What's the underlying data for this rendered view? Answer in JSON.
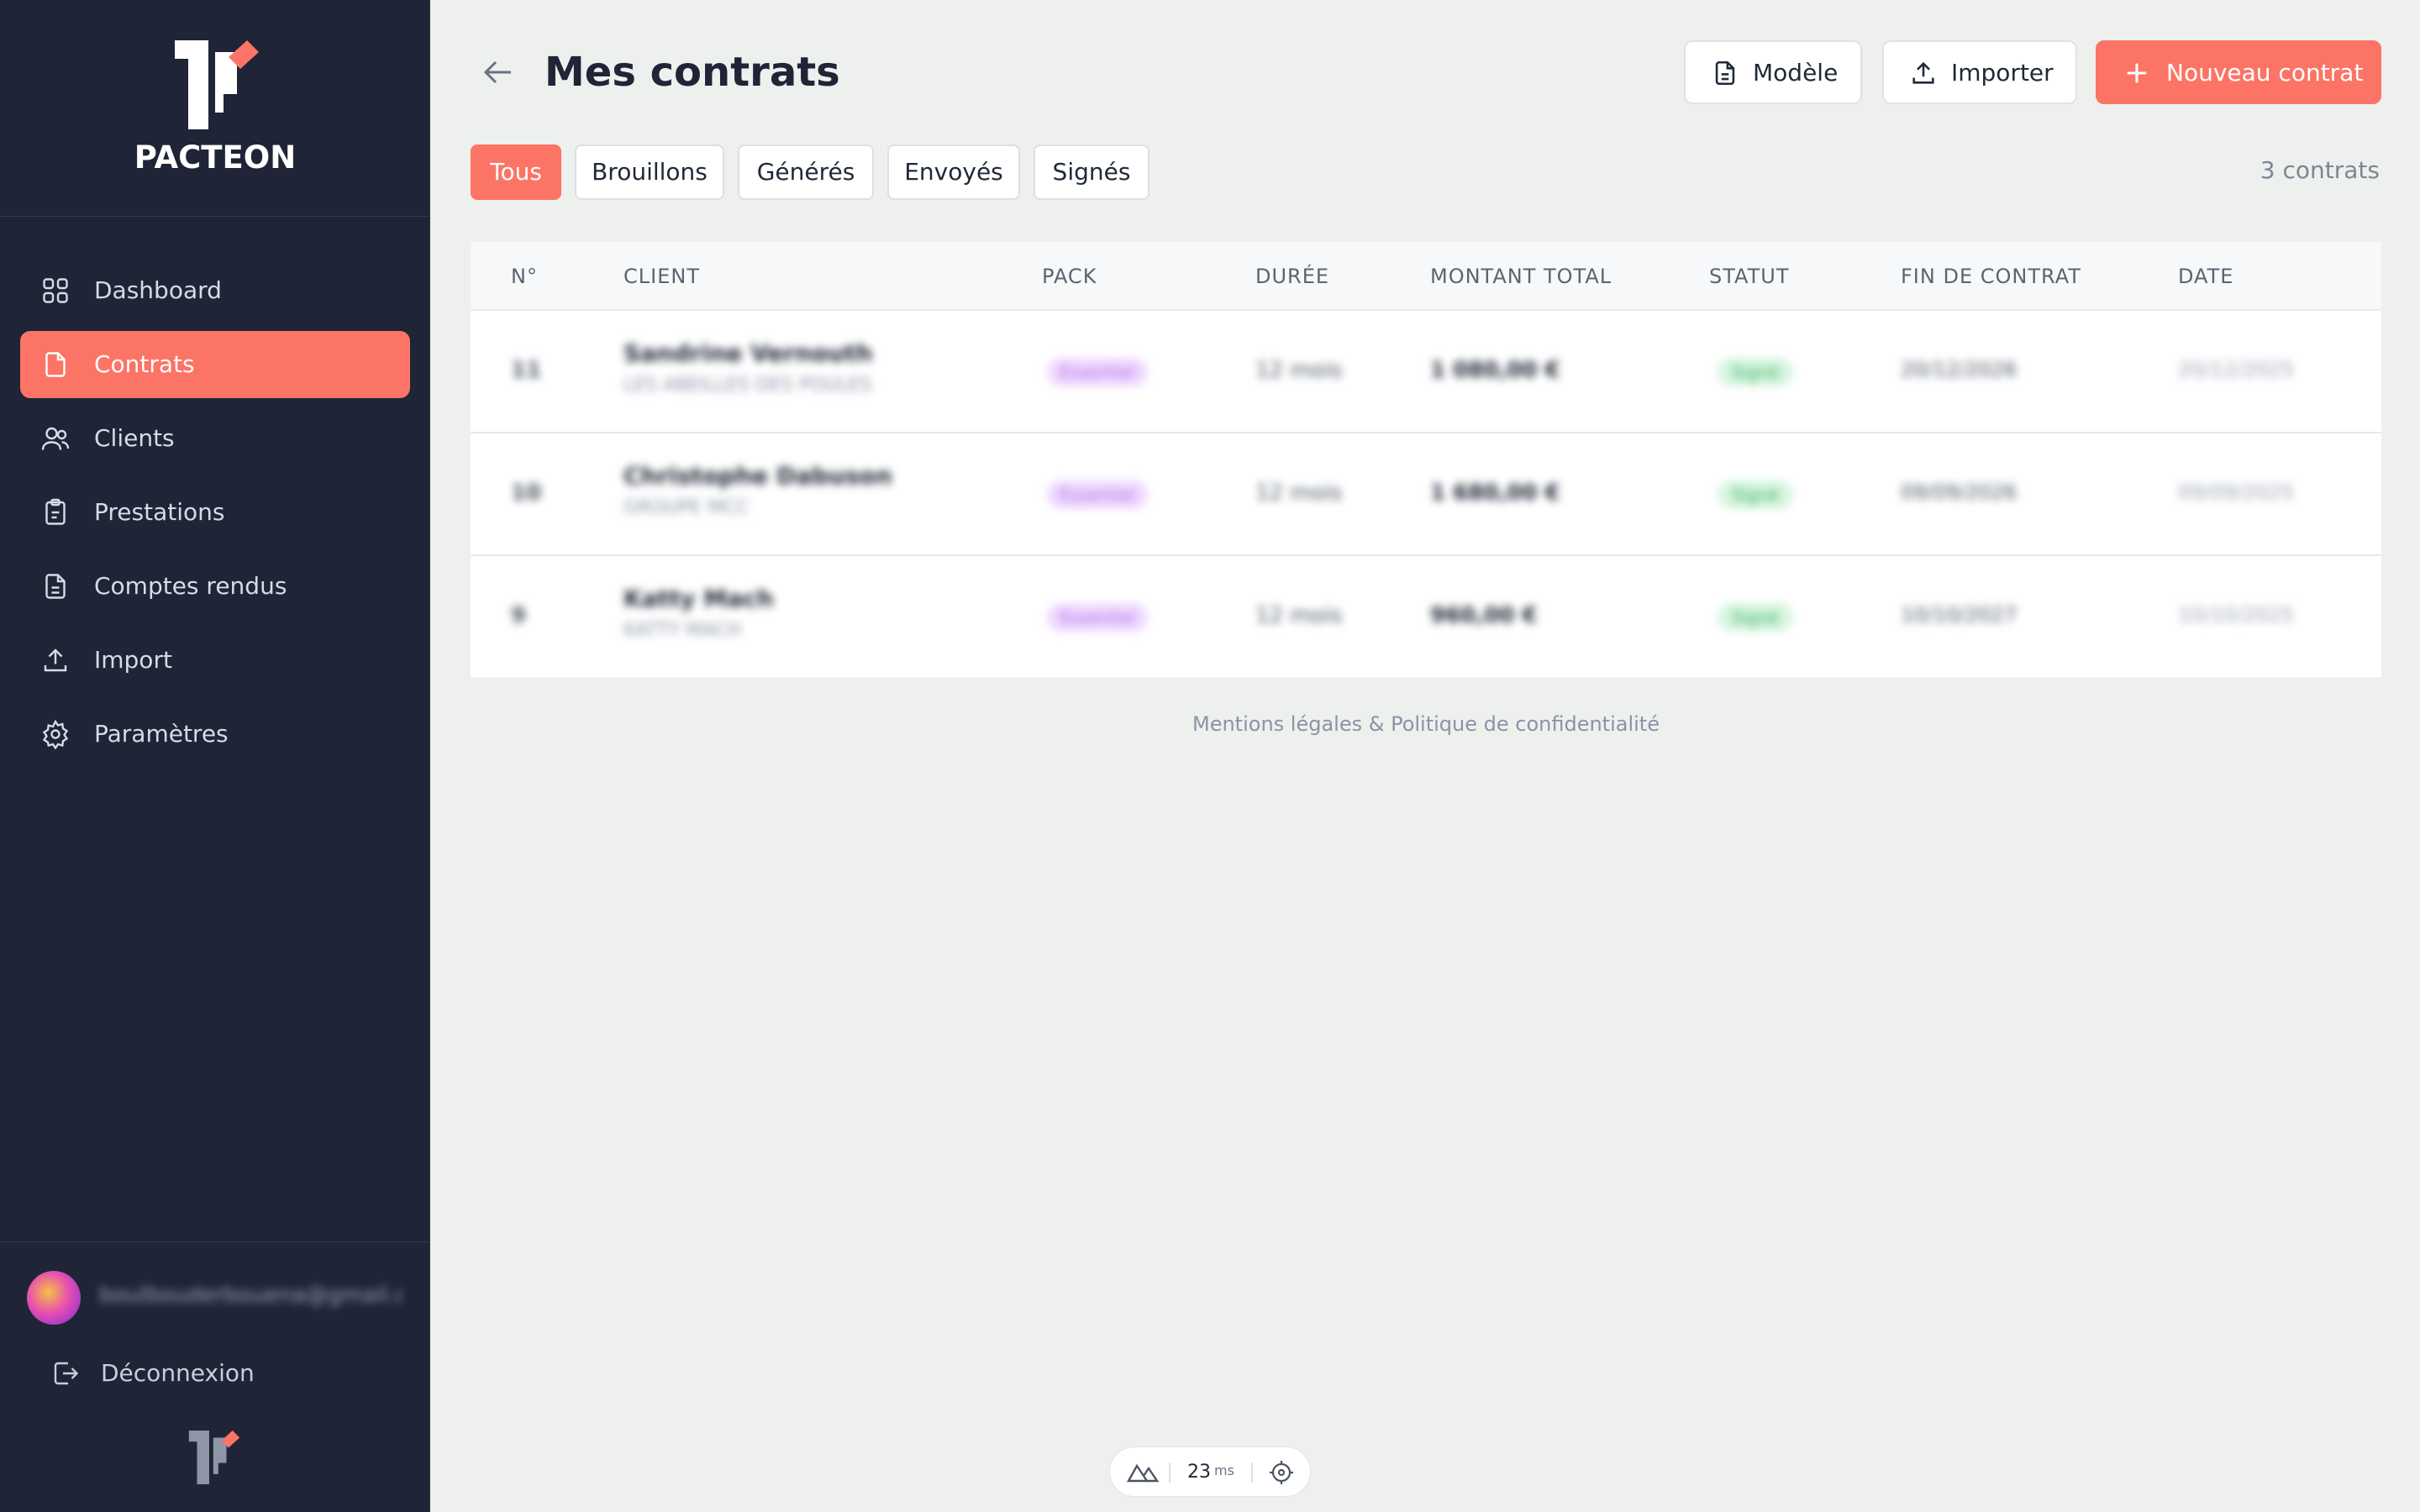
{
  "brand": {
    "name": "PACTEON",
    "accent": "#fb7466",
    "sidebar_bg": "#1f2437"
  },
  "sidebar": {
    "items": [
      {
        "label": "Dashboard",
        "icon": "grid-icon",
        "active": false
      },
      {
        "label": "Contrats",
        "icon": "document-icon",
        "active": true
      },
      {
        "label": "Clients",
        "icon": "users-icon",
        "active": false
      },
      {
        "label": "Prestations",
        "icon": "clipboard-icon",
        "active": false
      },
      {
        "label": "Comptes rendus",
        "icon": "file-text-icon",
        "active": false
      },
      {
        "label": "Import",
        "icon": "upload-icon",
        "active": false
      },
      {
        "label": "Paramètres",
        "icon": "gear-icon",
        "active": false
      }
    ],
    "user_email": "boulbouderbouena@gmail.c...",
    "logout_label": "Déconnexion"
  },
  "header": {
    "title": "Mes contrats",
    "buttons": {
      "model": "Modèle",
      "import": "Importer",
      "new": "Nouveau contrat"
    }
  },
  "filters": {
    "tabs": [
      "Tous",
      "Brouillons",
      "Générés",
      "Envoyés",
      "Signés"
    ],
    "active": "Tous",
    "count": "3 contrats"
  },
  "table": {
    "columns": [
      "N°",
      "CLIENT",
      "PACK",
      "DURÉE",
      "MONTANT TOTAL",
      "STATUT",
      "FIN DE CONTRAT",
      "DATE"
    ],
    "rows": [
      {
        "num": "11",
        "client": "Sandrine Vernouth",
        "client_sub": "LES ABEILLES DES POULES",
        "pack": "Essentiel",
        "duree": "12 mois",
        "montant": "1 080,00 €",
        "statut": "Signé",
        "fin": "20/12/2026",
        "date": "20/12/2025"
      },
      {
        "num": "10",
        "client": "Christophe Dabuson",
        "client_sub": "GROUPE MCC",
        "pack": "Essentiel",
        "duree": "12 mois",
        "montant": "1 680,00 €",
        "statut": "Signé",
        "fin": "09/09/2026",
        "date": "09/09/2025"
      },
      {
        "num": "9",
        "client": "Katty Mach",
        "client_sub": "KATTY MACH",
        "pack": "Essentiel",
        "duree": "12 mois",
        "montant": "960,00 €",
        "statut": "Signé",
        "fin": "10/10/2027",
        "date": "10/10/2025"
      }
    ]
  },
  "footer": {
    "links": "Mentions légales & Politique de confidentialité"
  },
  "devtools": {
    "value": "23",
    "unit": "ms"
  }
}
